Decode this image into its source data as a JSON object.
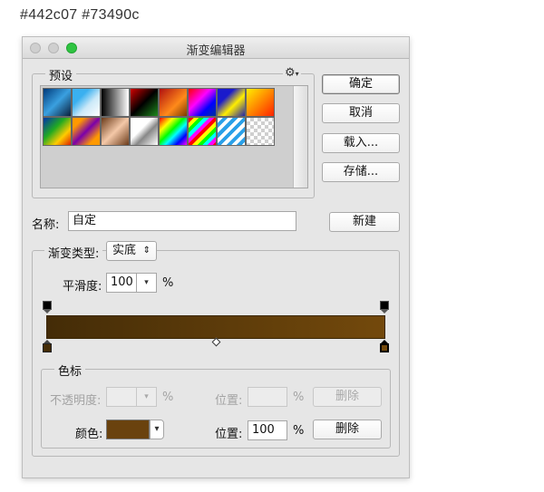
{
  "caption": "#442c07  #73490c",
  "window": {
    "title": "渐变编辑器"
  },
  "presets": {
    "legend": "预设",
    "gear": "⚙",
    "gear_caret": "▾",
    "swatches": [
      "linear-gradient(135deg,#003a7a,#3aa0e0,#0b1f3a)",
      "linear-gradient(135deg,#3ab0f0 30%,#cce9f8 60%,#ffffff 100%)",
      "linear-gradient(90deg,#000000,#ffffff)",
      "linear-gradient(135deg,#d10000,#000000 50%,#1c8a1c)",
      "linear-gradient(135deg,#b01010,#ff8a1a 60%,#7a3b00)",
      "linear-gradient(135deg,#ff0000,#ff00ff 40%,#0000ff 70%,#003399)",
      "linear-gradient(135deg,#1a1acc 30%,#ffee00 60%,#2222aa)",
      "linear-gradient(135deg,#ffee00,#ff8800 50%,#ff2200)",
      "linear-gradient(135deg,#0033aa,#22aa22 40%,#ffcc00 70%,#dd2200)",
      "linear-gradient(135deg,#ff9900 20%,#7a00aa 50%,#ff9900 80%)",
      "linear-gradient(135deg,#6b3b1a,#f4c8a8 50%,#6b3b1a)",
      "linear-gradient(135deg,#ffffff 40%,#888888 60%,#ffffff)",
      "linear-gradient(135deg,#ff0000,#ffff00 25%,#00ff00 45%,#00ffff 60%,#0000ff 80%,#ff00ff)",
      "repeating-linear-gradient(135deg,#ff0000 0 4px,#ffff00 4px 8px,#00ff00 8px 12px,#00ffff 12px 16px,#ff00ff 16px 20px)",
      "repeating-linear-gradient(135deg,#ffffff 0 4px,#2aa0e8 4px 8px)",
      "repeating-conic-gradient(#cfcfcf 0 25%,#ffffff 0 50%) 0 0/8px 8px"
    ]
  },
  "buttons": {
    "ok": "确定",
    "cancel": "取消",
    "load": "载入...",
    "save": "存储...",
    "new": "新建",
    "delete": "删除"
  },
  "name_row": {
    "label": "名称:",
    "value": "自定"
  },
  "gradient_type": {
    "label": "渐变类型:",
    "value": "实底",
    "caret": "⇕"
  },
  "smoothness": {
    "label": "平滑度:",
    "value": "100",
    "unit": "%",
    "caret": "▾"
  },
  "colors": {
    "left": "#442c07",
    "right": "#73490c"
  },
  "stops_group": {
    "legend": "色标",
    "opacity_label": "不透明度:",
    "opacity_unit": "%",
    "opacity_caret": "▾",
    "opacity_location_label": "位置:",
    "opacity_location_unit": "%",
    "color_label": "颜色:",
    "color_value": "#6a420e",
    "color_caret": "▾",
    "color_location_label": "位置:",
    "color_location_value": "100",
    "color_location_unit": "%"
  }
}
